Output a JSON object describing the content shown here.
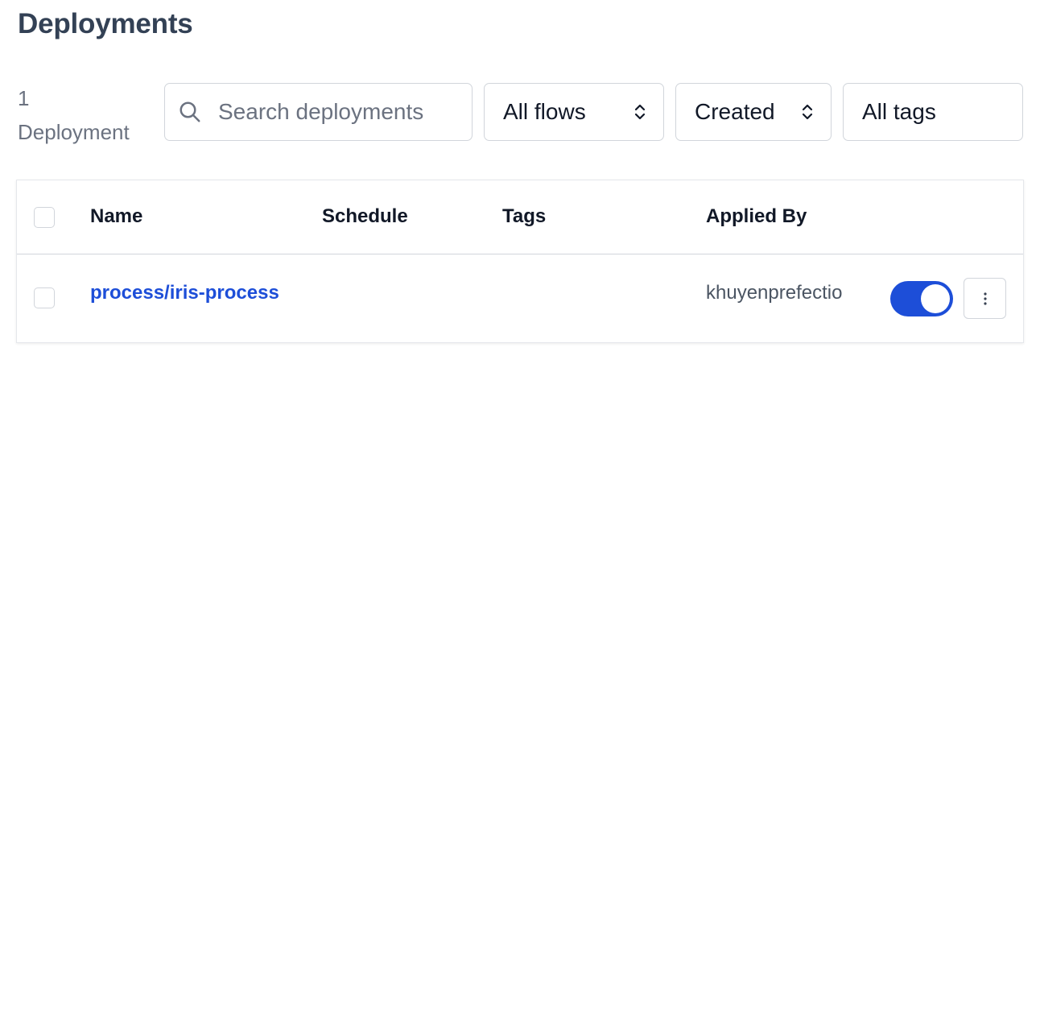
{
  "header": {
    "title": "Deployments"
  },
  "summary": {
    "count": "1",
    "unit": "Deployment"
  },
  "filters": {
    "search_placeholder": "Search deployments",
    "flows_select": "All flows",
    "sort_select": "Created",
    "tags_select": "All tags"
  },
  "table": {
    "columns": [
      "Name",
      "Schedule",
      "Tags",
      "Applied By"
    ],
    "rows": [
      {
        "name": "process/iris-process",
        "schedule": "",
        "tags": "",
        "applied_by": "khuyenprefectio",
        "active": true
      }
    ]
  },
  "colors": {
    "accent": "#1d4ed8",
    "title": "#334155",
    "muted": "#6b7280",
    "border": "#d1d5db"
  },
  "icons": {
    "search": "search-icon",
    "select": "chevron-up-down-icon",
    "menu": "vertical-ellipsis-icon"
  }
}
